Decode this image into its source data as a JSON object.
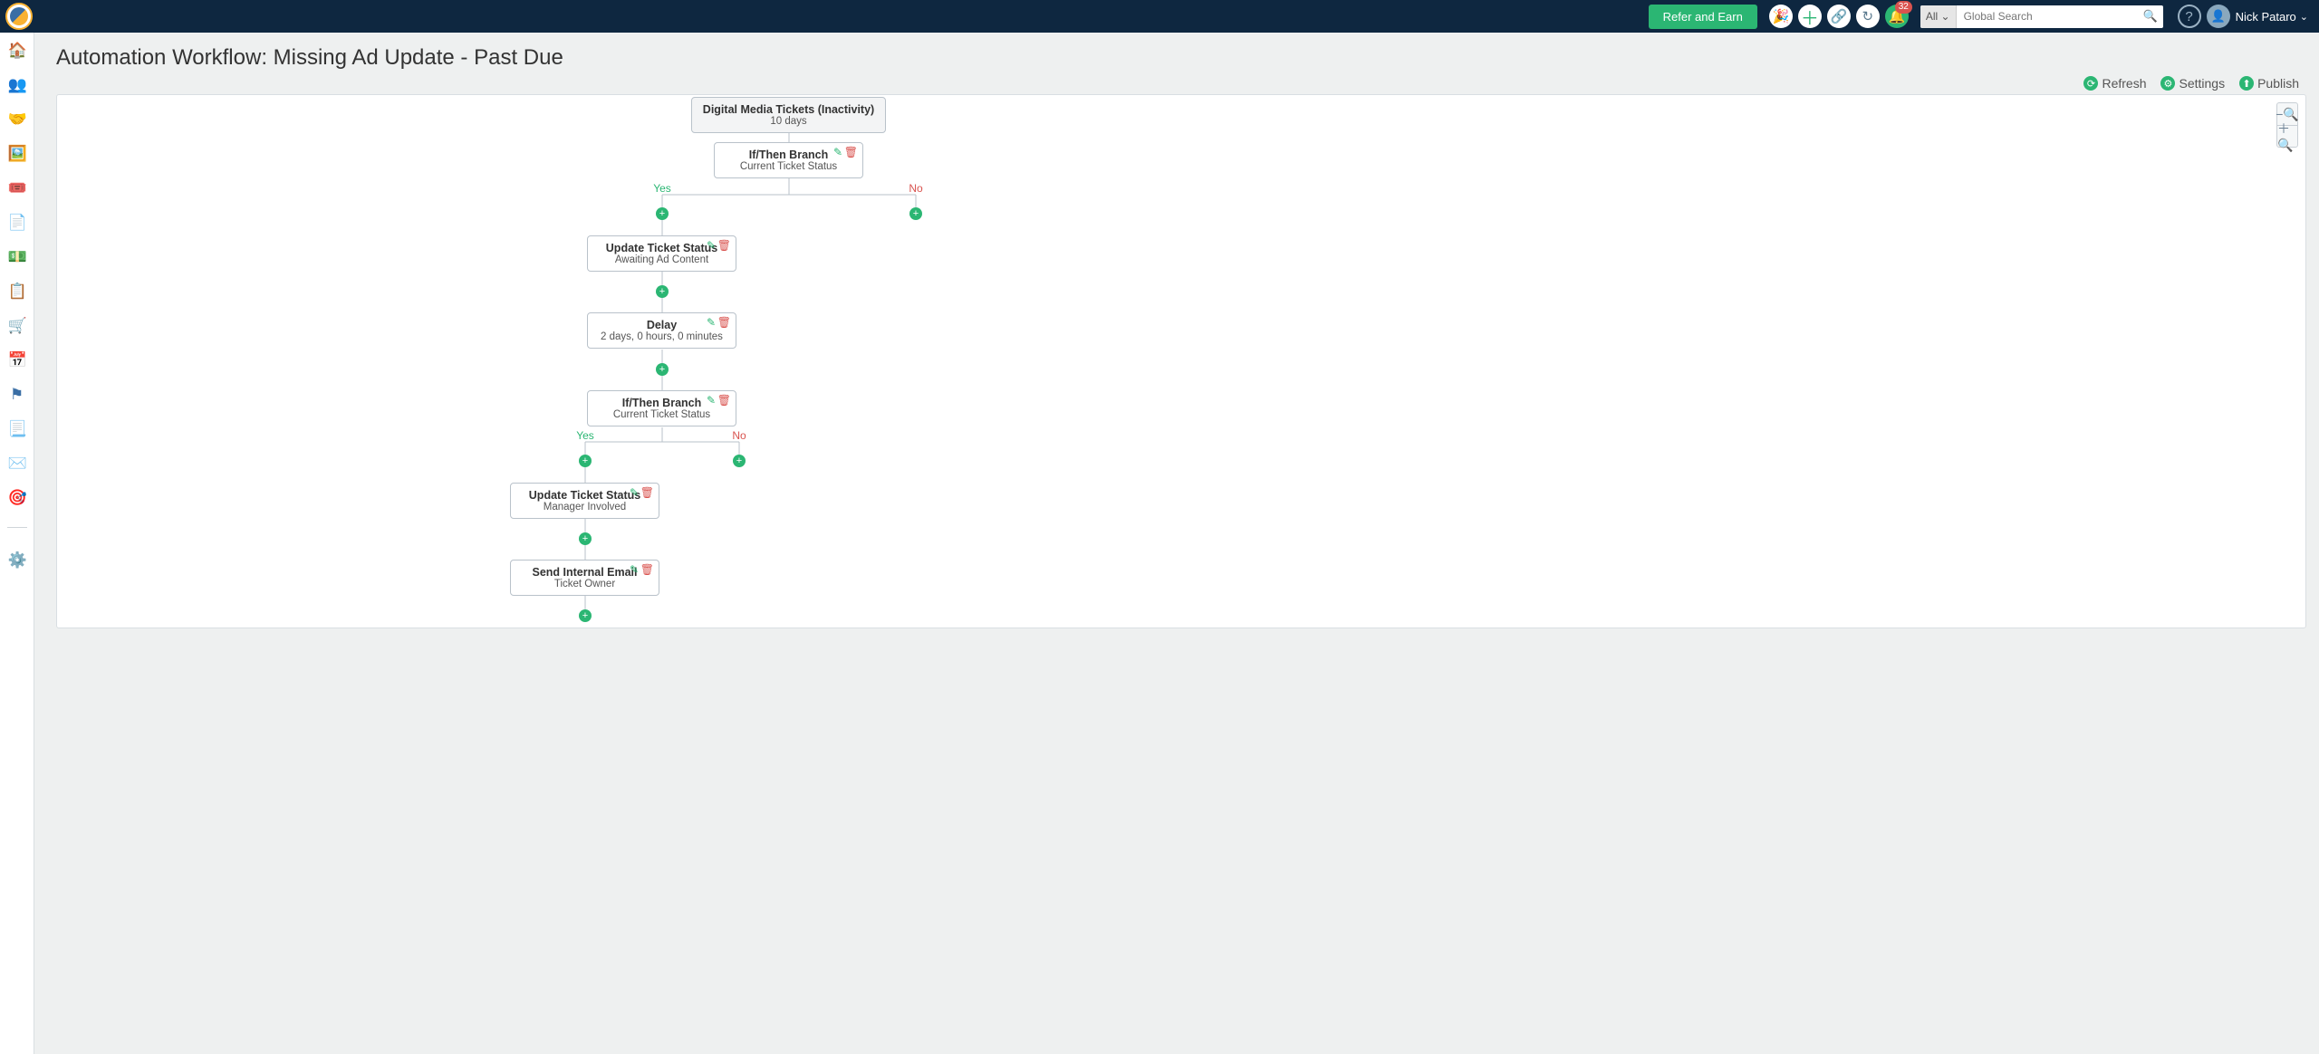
{
  "header": {
    "refer_label": "Refer and Earn",
    "notification_count": "32",
    "search_scope": "All",
    "search_placeholder": "Global Search",
    "user_name": "Nick Pataro"
  },
  "page": {
    "title": "Automation Workflow: Missing Ad Update - Past Due"
  },
  "actions": {
    "refresh": "Refresh",
    "settings": "Settings",
    "publish": "Publish"
  },
  "branch_labels": {
    "yes": "Yes",
    "no": "No"
  },
  "nodes": {
    "trigger": {
      "title": "Digital Media Tickets (Inactivity)",
      "sub": "10 days"
    },
    "branch1": {
      "title": "If/Then Branch",
      "sub": "Current Ticket Status"
    },
    "update1": {
      "title": "Update Ticket Status",
      "sub": "Awaiting Ad Content"
    },
    "delay": {
      "title": "Delay",
      "sub": "2 days, 0 hours, 0 minutes"
    },
    "branch2": {
      "title": "If/Then Branch",
      "sub": "Current Ticket Status"
    },
    "update2": {
      "title": "Update Ticket Status",
      "sub": "Manager Involved"
    },
    "email": {
      "title": "Send Internal Email",
      "sub": "Ticket Owner"
    }
  }
}
